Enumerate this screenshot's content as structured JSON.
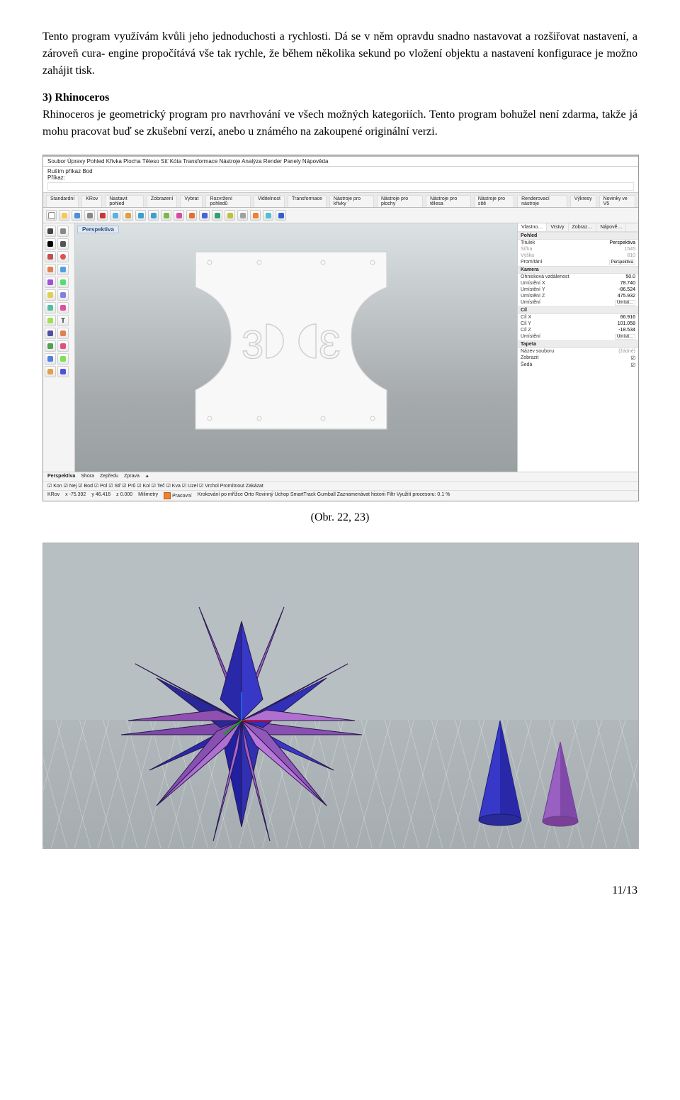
{
  "intro_paragraph": "Tento program využívám kvůli jeho jednoduchosti a rychlosti. Dá se v něm opravdu snadno nastavovat a rozšiřovat nastavení, a zároveň cura- engine propočítává vše tak rychle, že během několika sekund po vložení objektu a nastavení konfigurace je možno zahájit tisk.",
  "section3": {
    "heading": "3) Rhinoceros",
    "body": "Rhinoceros je geometrický program pro navrhování ve všech možných kategoriích. Tento program bohužel není zdarma, takže já mohu pracovat buď se zkušební verzí, anebo u známého na zakoupené originální verzi."
  },
  "caption": "(Obr. 22, 23)",
  "page_number": "11/13",
  "rhino": {
    "menubar": "Soubor  Úpravy  Pohled  Křivka  Plocha  Těleso  Síť  Kóta  Transformace  Nástroje  Analýza  Render  Panely  Nápověda",
    "cancel_line": "Ruším příkaz Bod",
    "prikaz_label": "Příkaz:",
    "tabs": [
      "Standardní",
      "KRov",
      "Nastavit pohled",
      "Zobrazení",
      "Vybrat",
      "Rozvržení pohledů",
      "Viditelnost",
      "Transformace",
      "Nástroje pro křivky",
      "Nástroje pro plochy",
      "Nástroje pro tělesa",
      "Nástroje pro sítě",
      "Renderovací nástroje",
      "Výkresy",
      "Novinky ve V5"
    ],
    "viewport_title": "Perspektiva",
    "model_text_left": "3",
    "model_text_right": "3",
    "rpane": {
      "tabs": [
        "Vlastno…",
        "Vrstvy",
        "Zobraz…",
        "Nápově…"
      ],
      "section_pohled": "Pohled",
      "titulek_k": "Titulek",
      "titulek_v": "Perspektiva",
      "sirka_k": "Šířka",
      "sirka_v": "1545",
      "vyska_k": "Výška",
      "vyska_v": "810",
      "promitani_k": "Promítání",
      "promitani_v": "Perspektiva",
      "section_kamera": "Kamera",
      "ohn_k": "Ohnisková vzdálenost",
      "ohn_v": "50.0",
      "umx_k": "Umístění X",
      "umx_v": "78.740",
      "umy_k": "Umístění Y",
      "umy_v": "-86.524",
      "umz_k": "Umístění Z",
      "umz_v": "475.932",
      "umisteni_k": "Umístění",
      "umisteni_v": "Umísti…",
      "section_cil": "Cíl",
      "cilx_k": "Cíl X",
      "cilx_v": "66.916",
      "cily_k": "Cíl Y",
      "cily_v": "101.058",
      "cilz_k": "Cíl Z",
      "cilz_v": "-18.534",
      "cil_um_k": "Umístění",
      "cil_um_v": "Umísti…",
      "section_tapeta": "Tapeta",
      "nazev_k": "Název souboru",
      "nazev_v": "(žádné)",
      "zobrazit_k": "Zobrazit",
      "seda_k": "Šedá"
    },
    "view_tabs": [
      "Perspektiva",
      "Shora",
      "Zepředu",
      "Zprava",
      "✦"
    ],
    "osnap": "☑ Kon ☑ Nej ☑ Bod ☑ Pol ☑ Stř ☑ Prů ☑ Kol ☑ Teč ☑ Kva ☑ Uzel ☑ Vrchol  Promítnout   Zakázat",
    "status": {
      "layer": "KRov",
      "x": "x -75.392",
      "y": "y 46.416",
      "z": "z 0.000",
      "units": "Milimetry",
      "pracovni": "Pracovní",
      "rest": "Krokování po mřížce   Orto   Rovinný   Uchop   SmartTrack   Gumball   Zaznamenávat historii   Filtr   Využití procesoru: 0.1 %"
    }
  }
}
